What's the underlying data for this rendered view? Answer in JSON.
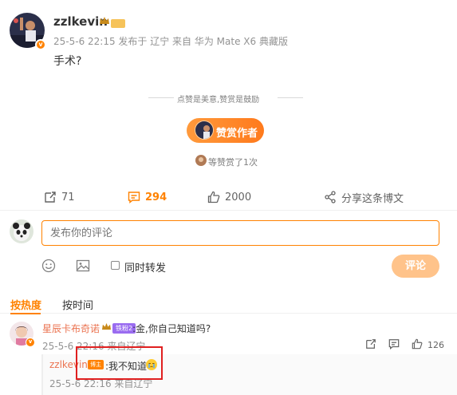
{
  "post": {
    "author": "zzlkevin",
    "meta": "25-5-6 22:15 发布于 辽宁 来自 华为 Mate X6 典藏版",
    "body": "手术?"
  },
  "reward": {
    "motto": "点赞是美意,赞赏是鼓励",
    "button_label": "赞赏作者",
    "count_text": "等赞赏了1次"
  },
  "actions": {
    "forward_count": "71",
    "comment_count": "294",
    "like_count": "2000",
    "share_label": "分享这条博文"
  },
  "composer": {
    "placeholder": "发布你的评论",
    "repost_label": "同时转发",
    "submit_label": "评论"
  },
  "sort": {
    "hot_label": "按热度",
    "time_label": "按时间"
  },
  "comment": {
    "user": "星辰卡布奇诺",
    "fan_badge": "铁粉2",
    "text": ":金,你自己知道吗?",
    "meta": "25-5-6 22:16 来自辽宁",
    "like_count": "126",
    "reply": {
      "user": "zzlkevin",
      "tag": "博主",
      "text": ":我不知道",
      "meta": "25-5-6 22:16 来自辽宁"
    }
  },
  "colors": {
    "accent": "#ff8200",
    "username": "#eb7350",
    "highlight": "#e02020"
  }
}
